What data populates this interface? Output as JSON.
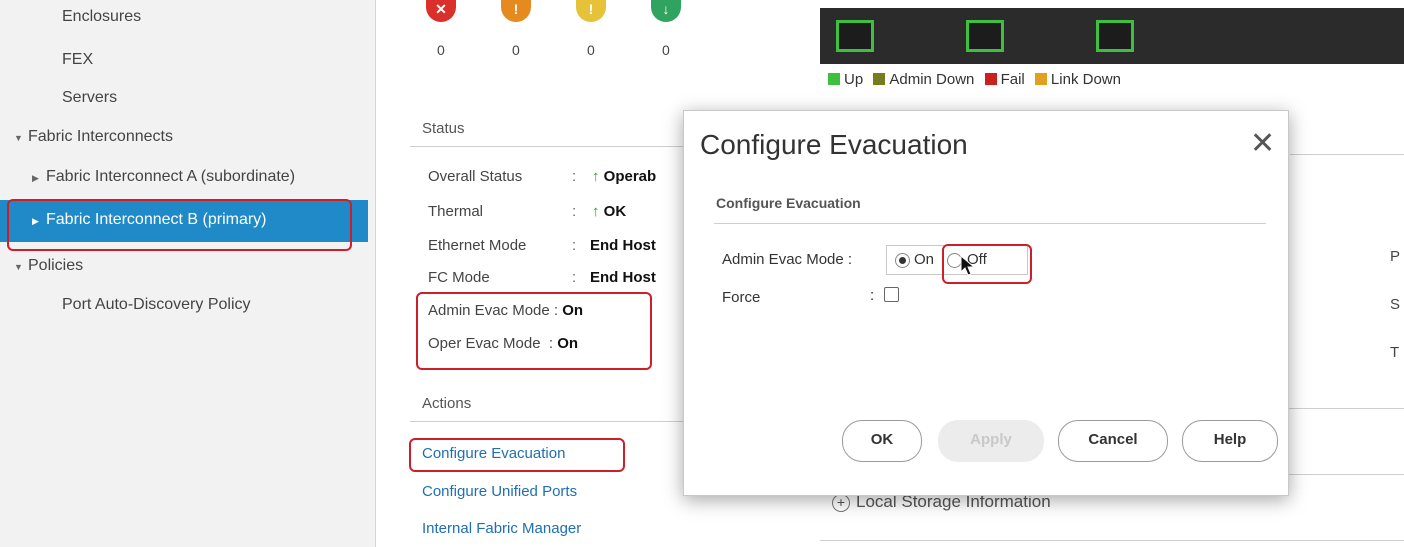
{
  "sidebar": {
    "items": [
      {
        "label": "Enclosures"
      },
      {
        "label": "FEX"
      },
      {
        "label": "Servers"
      },
      {
        "label": "Fabric Interconnects"
      },
      {
        "label": "Fabric Interconnect A (subordinate)"
      },
      {
        "label": "Fabric Interconnect B (primary)"
      },
      {
        "label": "Policies"
      },
      {
        "label": "Port Auto-Discovery Policy"
      }
    ]
  },
  "faults": {
    "counts": [
      "0",
      "0",
      "0",
      "0"
    ],
    "colors": [
      "#d9302c",
      "#e58a1f",
      "#e5c23a",
      "#2fa35f"
    ],
    "icons": [
      "critical-icon",
      "major-icon",
      "minor-icon",
      "warning-icon"
    ]
  },
  "legend": {
    "items": [
      {
        "label": "Up",
        "color": "#3fbf3f"
      },
      {
        "label": "Admin Down",
        "color": "#7a7a1e"
      },
      {
        "label": "Fail",
        "color": "#cc1f1f"
      },
      {
        "label": "Link Down",
        "color": "#e0a020"
      }
    ]
  },
  "status": {
    "title": "Status",
    "rows": [
      {
        "label": "Overall Status",
        "value": "Operab"
      },
      {
        "label": "Thermal",
        "value": "OK"
      },
      {
        "label": "Ethernet Mode",
        "value": "End Host"
      },
      {
        "label": "FC Mode",
        "value": "End Host"
      },
      {
        "label": "Admin Evac Mode",
        "value": "On"
      },
      {
        "label": "Oper Evac Mode",
        "value": "On"
      }
    ]
  },
  "actions": {
    "title": "Actions",
    "links": [
      "Configure Evacuation",
      "Configure Unified Ports",
      "Internal Fabric Manager"
    ]
  },
  "right_partial": {
    "letters": [
      "P",
      "S",
      "T"
    ],
    "section": "Local Storage Information"
  },
  "dialog": {
    "title": "Configure Evacuation",
    "subtitle": "Configure Evacuation",
    "admin_evac_label": "Admin Evac Mode :",
    "admin_evac_options": [
      "On",
      "Off"
    ],
    "admin_evac_selected": "On",
    "force_label": "Force",
    "force_sep": ":",
    "force_checked": false,
    "buttons": {
      "ok": "OK",
      "apply": "Apply",
      "cancel": "Cancel",
      "help": "Help"
    }
  }
}
